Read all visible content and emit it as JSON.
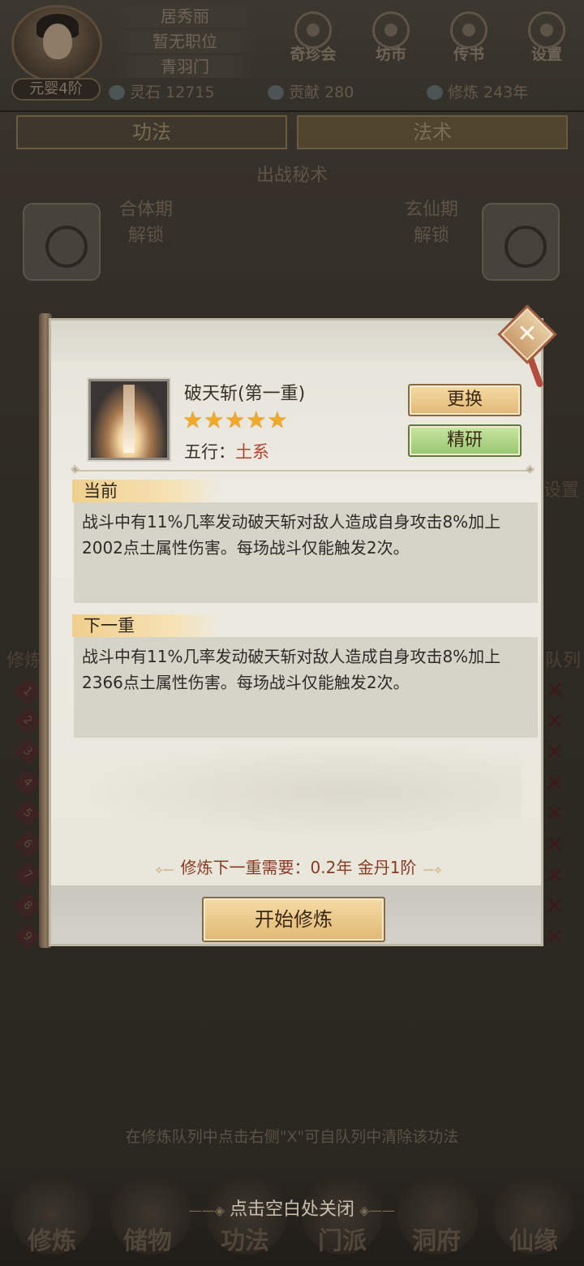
{
  "player": {
    "name": "居秀丽",
    "position": "暂无职位",
    "sect": "青羽门",
    "realm": "元婴4阶"
  },
  "top_buttons": [
    {
      "label": "奇珍会",
      "icon": "treasure-icon"
    },
    {
      "label": "坊市",
      "icon": "market-icon"
    },
    {
      "label": "传书",
      "icon": "letter-icon"
    },
    {
      "label": "设置",
      "icon": "gear-icon"
    }
  ],
  "stats": {
    "spirit_stone": "灵石 12715",
    "contribution": "贡献 280",
    "cultivation": "修炼 243年"
  },
  "tabs": [
    "功法",
    "法术"
  ],
  "active_tab": "法术",
  "battle_section": {
    "title": "出战秘术",
    "slots": [
      {
        "stage": "合体期",
        "status": "解锁"
      },
      {
        "stage": "玄仙期",
        "status": "解锁"
      }
    ]
  },
  "background_side": {
    "left_label": "修炼",
    "right_label": "队列",
    "right_top": "设置",
    "queue_numbers": [
      "1",
      "2",
      "3",
      "4",
      "5",
      "6",
      "7",
      "8",
      "9"
    ]
  },
  "bottom_hint": "在修炼队列中点击右侧\"X\"可自队列中清除该功法",
  "close_hint": "点击空白处关闭",
  "nav": [
    "修炼",
    "储物",
    "功法",
    "门派",
    "洞府",
    "仙缘"
  ],
  "modal": {
    "skill_name": "破天斩(第一重)",
    "stars": 5,
    "stars_text": "★★★★★",
    "element_label": "五行：",
    "element_value": "土系",
    "btn_change": "更换",
    "btn_refine": "精研",
    "current_title": "当前",
    "current_desc": "战斗中有11%几率发动破天斩对敌人造成自身攻击8%加上2002点土属性伤害。每场战斗仅能触发2次。",
    "next_title": "下一重",
    "next_desc": "战斗中有11%几率发动破天斩对敌人造成自身攻击8%加上2366点土属性伤害。每场战斗仅能触发2次。",
    "requirement": "修炼下一重需要：0.2年  金丹1阶",
    "start_button": "开始修炼",
    "close_icon": "close-icon"
  },
  "colors": {
    "element_earth": "#b2422e",
    "star": "#f2a92a",
    "button_gold": "#e1b873",
    "button_green": "#95c66e"
  }
}
